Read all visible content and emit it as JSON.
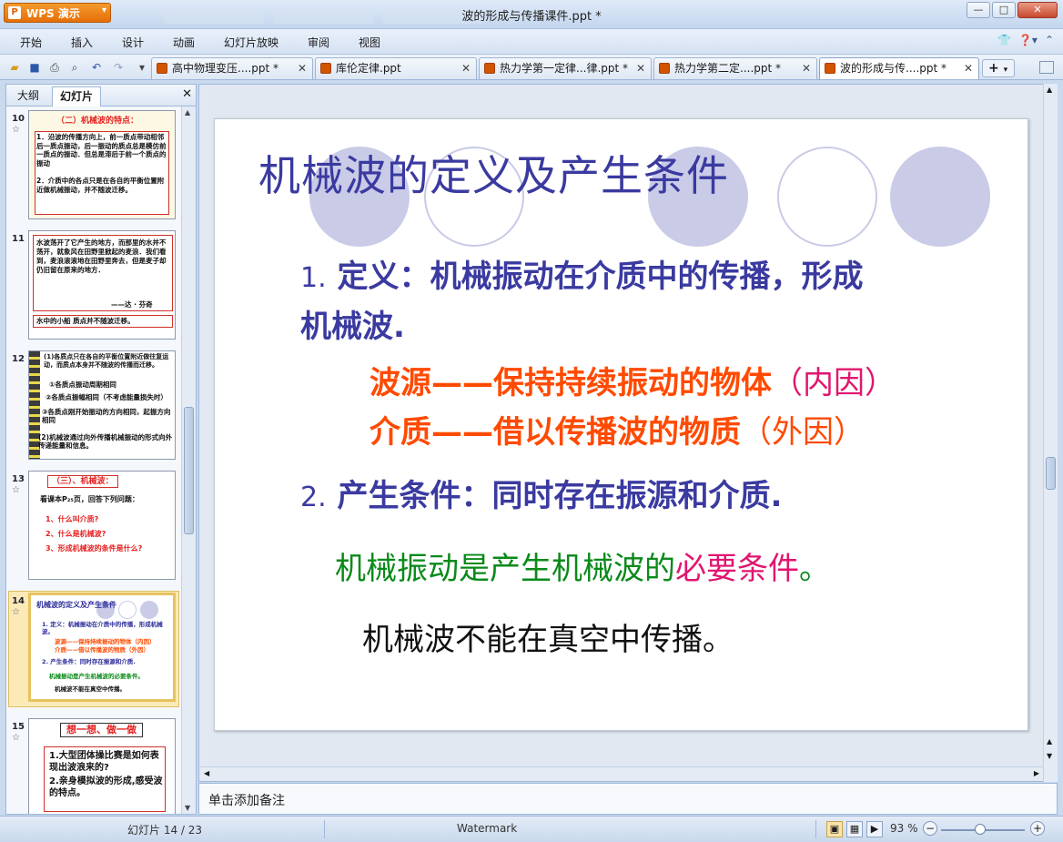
{
  "window": {
    "title": "波的形成与传播课件.ppt *",
    "app_label": "WPS 演示",
    "logo_glyph": "P",
    "buttons": {
      "minimize": "—",
      "restore": "□",
      "close": "✕"
    }
  },
  "menu": {
    "items": [
      "开始",
      "插入",
      "设计",
      "动画",
      "幻灯片放映",
      "审阅",
      "视图"
    ],
    "right_icons": [
      "shirt-icon",
      "help-icon"
    ]
  },
  "doc_tabs": [
    {
      "label": "高中物理变压....ppt *",
      "active": false
    },
    {
      "label": "库伦定律.ppt",
      "active": false
    },
    {
      "label": "热力学第一定律...律.ppt *",
      "active": false
    },
    {
      "label": "热力学第二定....ppt *",
      "active": false
    },
    {
      "label": "波的形成与传....ppt *",
      "active": true
    }
  ],
  "left_panel": {
    "tabs": [
      "大纲",
      "幻灯片"
    ],
    "active_tab": "幻灯片",
    "slides": [
      {
        "number": "10",
        "heading": "（二）机械波的特点：",
        "lines": [
          "1．沿波的传播方向上，前一质点带动相邻后一质点振动，后一振动的质点总是模仿前一质点的振动．但总是滞后于前一个质点的振动",
          "2．介质中的各点只是在各自的平衡位置附近做机械振动，并不随波迁移。"
        ]
      },
      {
        "number": "11",
        "lines": [
          "水波荡开了它产生的地方，而那里的水并不荡开，就象风在田野里掀起的麦浪．我们看到，麦浪滚滚地在田野里奔去，但是麦子却仍旧留在原来的地方．",
          "——达 · 芬奇"
        ],
        "caption": "水中的小船    质点并不随波迁移。"
      },
      {
        "number": "12",
        "lines": [
          "(1)各质点只在各自的平衡位置附近做往复运动，而质点本身并不随波的传播而迁移。",
          "①各质点振动周期相同",
          "②各质点振幅相同（不考虑能量损失时）",
          "③各质点刚开始振动的方向相同，起振方向相同",
          "(2)机械波通过向外传播机械振动的形式向外传递能量和信息。"
        ]
      },
      {
        "number": "13",
        "heading": "（三）、机械波：",
        "intro": "看课本P₂₅页，回答下列问题：",
        "lines": [
          "1、什么叫介质?",
          "2、什么是机械波?",
          "3、形成机械波的条件是什么?"
        ]
      },
      {
        "number": "14",
        "heading": "机械波的定义及产生条件",
        "lines": [
          "1. 定义：机械振动在介质中的传播，形成机械波。",
          "波源——保持持续振动的物体（内因）",
          "介质——借以传播波的物质（外因）",
          "2. 产生条件：同时存在振源和介质.",
          "机械振动是产生机械波的必要条件。",
          "机械波不能在真空中传播。"
        ]
      },
      {
        "number": "15",
        "heading": "想一想、做一做",
        "lines": [
          "1.大型团体操比赛是如何表现出波浪来的?",
          "2.亲身模拟波的形成,感受波的特点。"
        ]
      }
    ]
  },
  "slide": {
    "title": "机械波的定义及产生条件",
    "def_num": "1.",
    "def_line1": "定义：机械振动在介质中的传播，形成",
    "def_line2": "机械波.",
    "source_a": "波源——保持持续振动的物体",
    "source_b": "（内因）",
    "medium_a": "介质——借以传播波的物质",
    "medium_b": "（外因）",
    "cond_num": "2.",
    "condition": "产生条件：同时存在振源和介质.",
    "necessary_a": "机械振动是产生机械波的",
    "necessary_b": "必要条件",
    "necessary_c": "。",
    "vacuum": "机械波不能在真空中传播。"
  },
  "notes_placeholder": "单击添加备注",
  "status": {
    "slide_counter": "幻灯片 14 / 23",
    "theme": "Watermark",
    "zoom": "93 %"
  },
  "colors": {
    "title_blue": "#3a3aa0",
    "body_blue": "#3a3aa0",
    "red_orange": "#ff4a00",
    "pink": "#e0166f",
    "green": "#0a8a1a",
    "circle": "#c9cbe7"
  }
}
